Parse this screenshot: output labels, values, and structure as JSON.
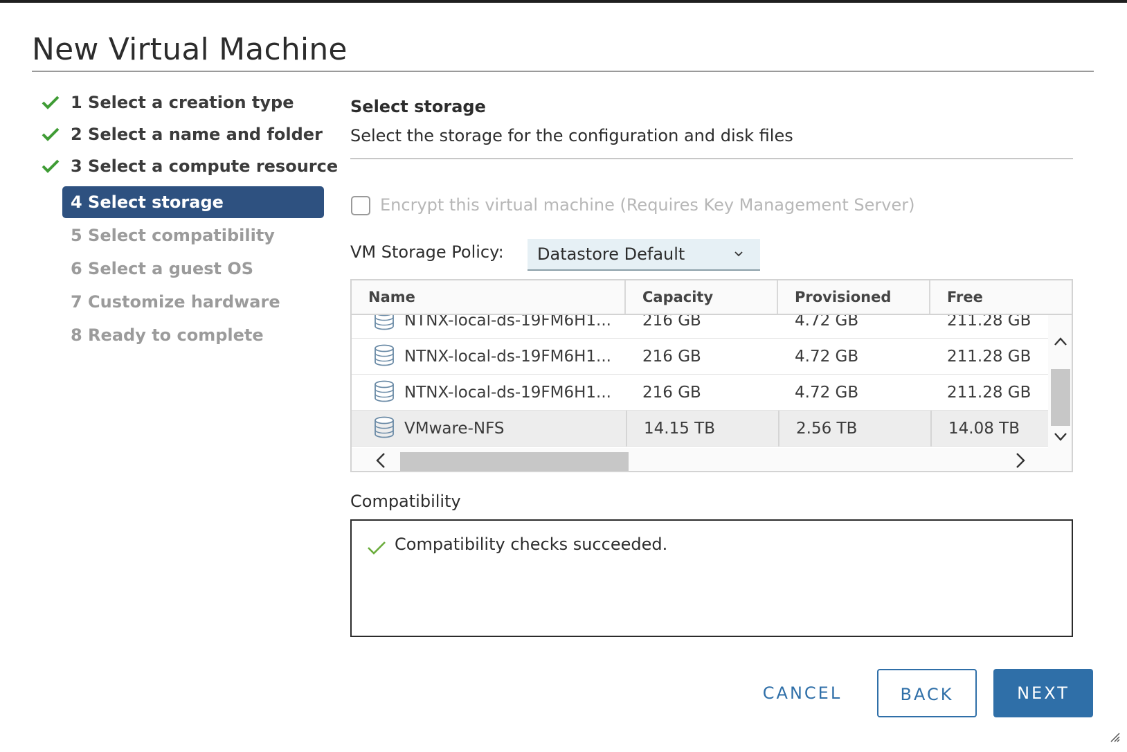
{
  "dialog": {
    "title": "New Virtual Machine"
  },
  "steps": [
    {
      "label": "1 Select a creation type",
      "state": "done"
    },
    {
      "label": "2 Select a name and folder",
      "state": "done"
    },
    {
      "label": "3 Select a compute resource",
      "state": "done"
    },
    {
      "label": "4 Select storage",
      "state": "active"
    },
    {
      "label": "5 Select compatibility",
      "state": "future"
    },
    {
      "label": "6 Select a guest OS",
      "state": "future"
    },
    {
      "label": "7 Customize hardware",
      "state": "future"
    },
    {
      "label": "8 Ready to complete",
      "state": "future"
    }
  ],
  "section": {
    "title": "Select storage",
    "description": "Select the storage for the configuration and disk files"
  },
  "encrypt": {
    "label": "Encrypt this virtual machine (Requires Key Management Server)",
    "checked": false,
    "enabled": false
  },
  "policy": {
    "label": "VM Storage Policy:",
    "value": "Datastore Default"
  },
  "grid": {
    "columns": [
      "Name",
      "Capacity",
      "Provisioned",
      "Free"
    ],
    "rows": [
      {
        "name": "NTNX-local-ds-19FM6H1...",
        "capacity": "216 GB",
        "provisioned": "4.72 GB",
        "free": "211.28 GB",
        "selected": false
      },
      {
        "name": "NTNX-local-ds-19FM6H1...",
        "capacity": "216 GB",
        "provisioned": "4.72 GB",
        "free": "211.28 GB",
        "selected": false
      },
      {
        "name": "NTNX-local-ds-19FM6H1...",
        "capacity": "216 GB",
        "provisioned": "4.72 GB",
        "free": "211.28 GB",
        "selected": false
      },
      {
        "name": "VMware-NFS",
        "capacity": "14.15 TB",
        "provisioned": "2.56 TB",
        "free": "14.08 TB",
        "selected": true
      }
    ]
  },
  "compatibility": {
    "label": "Compatibility",
    "message": "Compatibility checks succeeded."
  },
  "buttons": {
    "cancel": "CANCEL",
    "back": "BACK",
    "next": "NEXT"
  },
  "colors": {
    "accent": "#2f6fa8",
    "active_step": "#2e5180",
    "check": "#3f9c35"
  }
}
